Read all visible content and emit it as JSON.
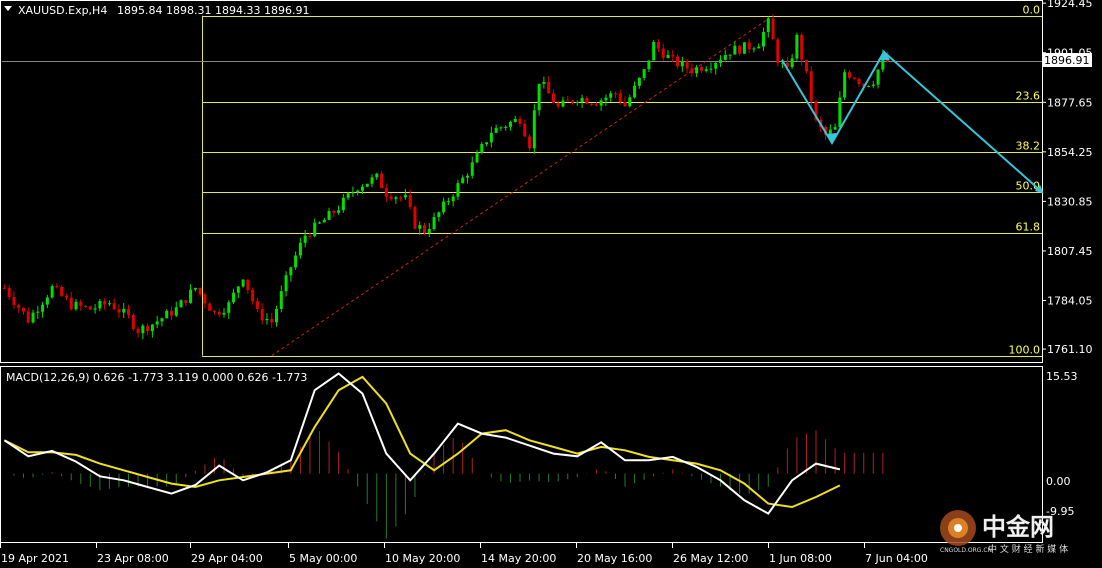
{
  "header": {
    "symbol": "XAUUSD.Exp,H4",
    "ohlc": "1895.84 1898.31 1894.33 1896.91"
  },
  "macd": {
    "label": "MACD(12,26,9) 0.626 -1.773 3.119 0.000 0.626 -1.773",
    "axis_top": "15.53",
    "axis_zero": "0.00",
    "axis_bottom": "-9.95"
  },
  "current_price": "1896.91",
  "colors": {
    "background": "#000000",
    "bull_candle": "#00e000",
    "bear_candle": "#e00000",
    "fib_lines": "#e6e645",
    "arrow": "#35c6dc",
    "trend_dashed": "#cc2222",
    "macd_line": "#ffffff",
    "signal_line": "#f0e020",
    "hist_pos": "#b02020",
    "hist_neg": "#2a7a2a"
  },
  "watermark": {
    "brand_cn": "中金网",
    "site": "CNGOLD.ORG.CN",
    "tagline": "中 文 财 经 新 媒 体"
  },
  "chart_data": [
    {
      "type": "candlestick",
      "title": "XAUUSD.Exp,H4",
      "price_ticks": [
        "1924.45",
        "1901.05",
        "1877.65",
        "1854.25",
        "1830.85",
        "1807.45",
        "1784.05",
        "1761.10"
      ],
      "ylim": [
        1755,
        1925
      ],
      "time_labels": [
        "19 Apr 2021",
        "23 Apr 08:00",
        "29 Apr 04:00",
        "5 May 00:00",
        "10 May 20:00",
        "14 May 20:00",
        "20 May 16:00",
        "26 May 12:00",
        "1 Jun 08:00",
        "7 Jun 04:00"
      ],
      "close_path": [
        [
          0,
          1790
        ],
        [
          5,
          1775
        ],
        [
          10,
          1790
        ],
        [
          14,
          1782
        ],
        [
          18,
          1780
        ],
        [
          22,
          1783
        ],
        [
          26,
          1776
        ],
        [
          28,
          1770
        ],
        [
          31,
          1773
        ],
        [
          36,
          1780
        ],
        [
          40,
          1790
        ],
        [
          44,
          1778
        ],
        [
          47,
          1782
        ],
        [
          50,
          1796
        ],
        [
          53,
          1778
        ],
        [
          56,
          1774
        ],
        [
          60,
          1800
        ],
        [
          63,
          1815
        ],
        [
          66,
          1820
        ],
        [
          70,
          1828
        ],
        [
          74,
          1838
        ],
        [
          78,
          1842
        ],
        [
          80,
          1835
        ],
        [
          84,
          1832
        ],
        [
          86,
          1820
        ],
        [
          88,
          1817
        ],
        [
          90,
          1822
        ],
        [
          94,
          1835
        ],
        [
          98,
          1848
        ],
        [
          102,
          1864
        ],
        [
          106,
          1868
        ],
        [
          108,
          1870
        ],
        [
          110,
          1858
        ],
        [
          112,
          1888
        ],
        [
          116,
          1875
        ],
        [
          120,
          1880
        ],
        [
          124,
          1878
        ],
        [
          128,
          1882
        ],
        [
          130,
          1876
        ],
        [
          134,
          1892
        ],
        [
          136,
          1905
        ],
        [
          140,
          1897
        ],
        [
          144,
          1893
        ],
        [
          148,
          1896
        ],
        [
          152,
          1902
        ],
        [
          156,
          1904
        ],
        [
          158,
          1906
        ],
        [
          160,
          1915
        ],
        [
          162,
          1898
        ],
        [
          164,
          1892
        ],
        [
          166,
          1908
        ],
        [
          168,
          1890
        ],
        [
          170,
          1868
        ],
        [
          172,
          1862
        ],
        [
          174,
          1865
        ],
        [
          176,
          1892
        ],
        [
          178,
          1890
        ],
        [
          180,
          1886
        ],
        [
          182,
          1888
        ],
        [
          184,
          1898
        ],
        [
          185,
          1896.91
        ]
      ],
      "fibonacci": [
        {
          "level": "0.0",
          "price": 1918.5
        },
        {
          "level": "23.6",
          "price": 1877.6
        },
        {
          "level": "38.2",
          "price": 1854.2
        },
        {
          "level": "50.0",
          "price": 1835.1
        },
        {
          "level": "61.8",
          "price": 1816.0
        },
        {
          "level": "100.0",
          "price": 1758.0
        }
      ],
      "projection_arrow": [
        [
          "1 Jun 04:00",
          1900
        ],
        [
          "3 Jun",
          1857
        ],
        [
          "7 Jun",
          1902
        ],
        [
          "10 Jun",
          1834
        ]
      ],
      "grid": false
    },
    {
      "type": "line",
      "title": "MACD(12,26,9)",
      "ylim": [
        -9.95,
        15.53
      ],
      "series": [],
      "x_index": [
        0,
        5,
        10,
        15,
        20,
        25,
        30,
        35,
        40,
        45,
        50,
        55,
        60,
        65,
        70,
        75,
        80,
        85,
        90,
        95,
        100,
        105,
        110,
        115,
        120,
        125,
        130,
        135,
        140,
        145,
        150,
        155,
        160,
        165,
        170,
        175,
        180,
        185
      ],
      "macd_values": [
        5.0,
        2.6,
        3.4,
        1.8,
        -0.4,
        -1.0,
        -2.0,
        -3.0,
        -1.7,
        1.2,
        -1.0,
        0.2,
        2.0,
        12.5,
        15.0,
        12.0,
        3.0,
        -1.0,
        3.0,
        7.5,
        6.0,
        5.4,
        4.2,
        3.0,
        2.6,
        4.7,
        2.0,
        2.0,
        2.5,
        1.0,
        -1.0,
        -4.0,
        -6.0,
        -1.0,
        1.5,
        0.626
      ],
      "signal_values": [
        5.0,
        3.2,
        3.2,
        2.8,
        1.5,
        0.5,
        -0.5,
        -1.5,
        -2.0,
        -1.0,
        -0.5,
        0.0,
        0.5,
        7.0,
        12.5,
        14.5,
        10.5,
        3.0,
        0.5,
        3.0,
        6.0,
        6.5,
        5.0,
        4.0,
        3.0,
        4.0,
        3.5,
        2.5,
        2.0,
        1.5,
        0.5,
        -1.5,
        -4.5,
        -5.0,
        -3.5,
        -1.773
      ]
    }
  ]
}
